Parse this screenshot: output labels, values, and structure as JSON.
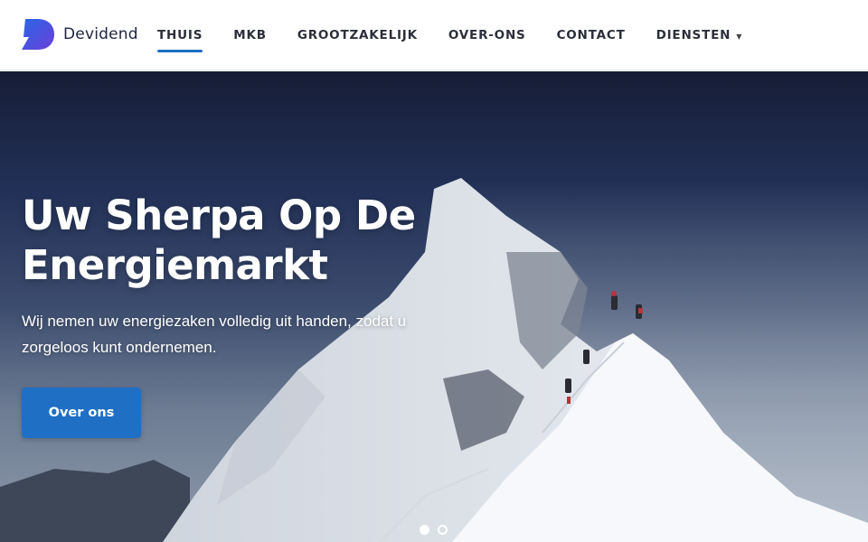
{
  "brand": {
    "name": "Devidend",
    "logo_icon": "devidend-d-logo",
    "accent": "#1e6fc3"
  },
  "nav": {
    "items": [
      {
        "label": "THUIS",
        "active": true
      },
      {
        "label": "MKB",
        "active": false
      },
      {
        "label": "GROOTZAKELIJK",
        "active": false
      },
      {
        "label": "OVER-ONS",
        "active": false
      },
      {
        "label": "CONTACT",
        "active": false
      },
      {
        "label": "DIENSTEN",
        "active": false,
        "dropdown": true
      }
    ],
    "dropdown_icon": "caret-down-icon"
  },
  "hero": {
    "title": "Uw Sherpa Op De Energiemarkt",
    "subtitle": "Wij nemen uw energiezaken volledig uit handen, zodat u zorgeloos kunt ondernemen.",
    "button_label": "Over ons",
    "button_color": "#1f6fc4",
    "slides_total": 2,
    "active_slide": 1
  }
}
